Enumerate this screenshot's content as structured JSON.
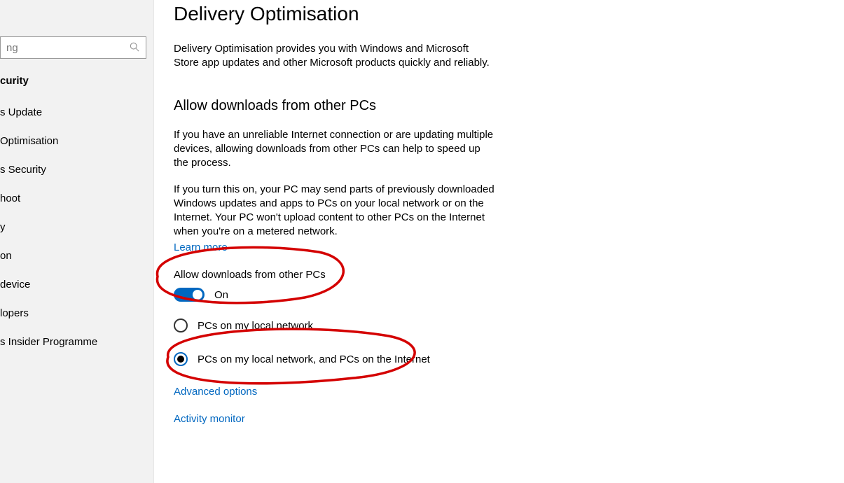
{
  "sidebar": {
    "search_value": "ng",
    "section_head": "curity",
    "items": [
      "s Update",
      "Optimisation",
      "s Security",
      "hoot",
      "y",
      "on",
      "device",
      "lopers",
      "s Insider Programme"
    ]
  },
  "page": {
    "title": "Delivery Optimisation",
    "intro": "Delivery Optimisation provides you with Windows and Microsoft Store app updates and other Microsoft products quickly and reliably.",
    "section_header": "Allow downloads from other PCs",
    "para1": "If you have an unreliable Internet connection or are updating multiple devices, allowing downloads from other PCs can help to speed up the process.",
    "para2": "If you turn this on, your PC may send parts of previously downloaded Windows updates and apps to PCs on your local network or on the Internet. Your PC won't upload content to other PCs on the Internet when you're on a metered network.",
    "learn_more": "Learn more",
    "toggle_label": "Allow downloads from other PCs",
    "toggle_state": "On",
    "radio_local": "PCs on my local network",
    "radio_internet": "PCs on my local network, and PCs on the Internet",
    "advanced": "Advanced options",
    "activity": "Activity monitor"
  }
}
